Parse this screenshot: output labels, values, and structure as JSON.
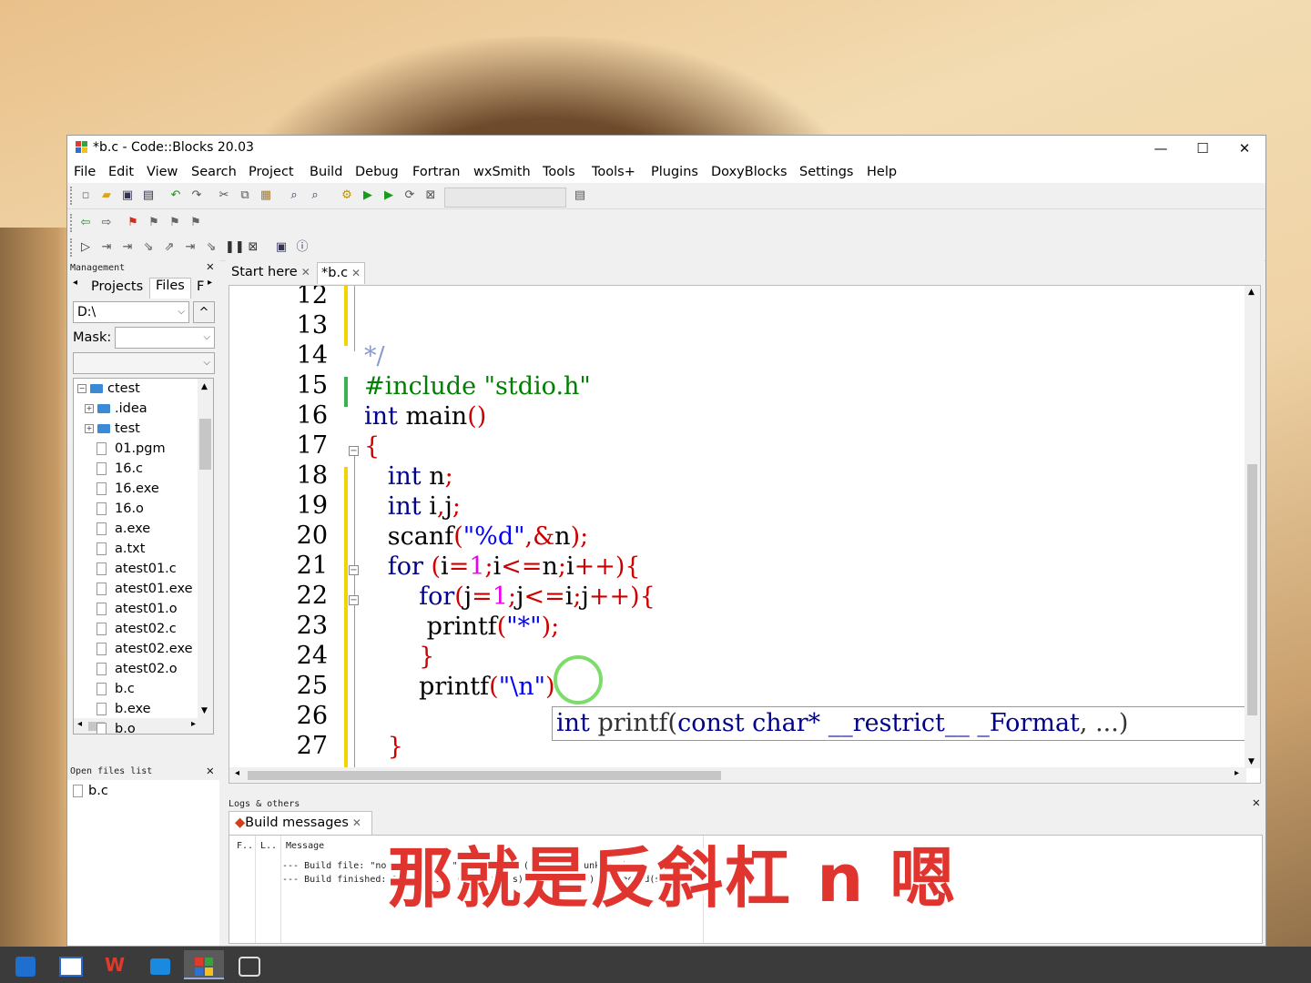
{
  "window": {
    "title": "*b.c - Code::Blocks 20.03",
    "minimize": "—",
    "maximize": "☐",
    "close": "✕"
  },
  "menu": [
    "File",
    "Edit",
    "View",
    "Search",
    "Project",
    "Build",
    "Debug",
    "Fortran",
    "wxSmith",
    "Tools",
    "Tools+",
    "Plugins",
    "DoxyBlocks",
    "Settings",
    "Help"
  ],
  "management": {
    "header": "Management",
    "tabs": [
      "Projects",
      "Files",
      "F"
    ],
    "path": "D:\\",
    "up_btn": "^",
    "mask_label": "Mask:",
    "tree": [
      {
        "name": "ctest",
        "type": "folder",
        "level": 0,
        "expander": "−"
      },
      {
        "name": ".idea",
        "type": "folder",
        "level": 1,
        "expander": "+"
      },
      {
        "name": "test",
        "type": "folder",
        "level": 1,
        "expander": "+"
      },
      {
        "name": "01.pgm",
        "type": "file",
        "level": 1
      },
      {
        "name": "16.c",
        "type": "file",
        "level": 1
      },
      {
        "name": "16.exe",
        "type": "file",
        "level": 1
      },
      {
        "name": "16.o",
        "type": "file",
        "level": 1
      },
      {
        "name": "a.exe",
        "type": "file",
        "level": 1
      },
      {
        "name": "a.txt",
        "type": "file",
        "level": 1
      },
      {
        "name": "atest01.c",
        "type": "file",
        "level": 1
      },
      {
        "name": "atest01.exe",
        "type": "file",
        "level": 1
      },
      {
        "name": "atest01.o",
        "type": "file",
        "level": 1
      },
      {
        "name": "atest02.c",
        "type": "file",
        "level": 1
      },
      {
        "name": "atest02.exe",
        "type": "file",
        "level": 1
      },
      {
        "name": "atest02.o",
        "type": "file",
        "level": 1
      },
      {
        "name": "b.c",
        "type": "file",
        "level": 1
      },
      {
        "name": "b.exe",
        "type": "file",
        "level": 1
      },
      {
        "name": "b.o",
        "type": "file",
        "level": 1
      }
    ]
  },
  "open_files": {
    "header": "Open files list",
    "files": [
      "b.c"
    ]
  },
  "editor": {
    "tabs": [
      {
        "label": "Start here",
        "active": false
      },
      {
        "label": "*b.c",
        "active": true
      }
    ],
    "line_numbers": [
      "12",
      "13",
      "14",
      "15",
      "16",
      "17",
      "18",
      "19",
      "20",
      "21",
      "22",
      "23",
      "24",
      "25",
      "26",
      "27"
    ],
    "calltip": {
      "ret": "int",
      "fn": "printf",
      "open": "(",
      "arg1": "const char* __restrict__ _Format",
      "sep": ", ",
      "rest": "...",
      "close": ")"
    }
  },
  "logs": {
    "header": "Logs & others",
    "tab": "Build messages",
    "columns": [
      "F..",
      "L..",
      "Message"
    ],
    "lines": [
      "--- Build file: \"no target\" in \"no project\" (compiler: unknown)",
      "--- Build finished: 0 error(s), 0 warning(s) (0 minute(s), 0 second(s))"
    ]
  },
  "subtitle": "那就是反斜杠 n 嗯",
  "colors": {
    "keyword": "#00008b",
    "preprocessor": "#008000",
    "string": "#0000ff",
    "operator": "#cc0000",
    "number": "#ee00ee",
    "subtitle": "#e0342f"
  }
}
